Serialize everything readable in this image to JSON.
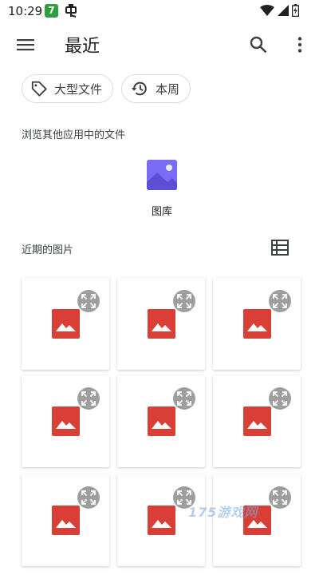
{
  "status_bar": {
    "time": "10:29",
    "app_badge": "7"
  },
  "app_bar": {
    "title": "最近",
    "menu_icon": "menu-icon",
    "search_icon": "search-icon",
    "more_icon": "more-vert-icon"
  },
  "filters": [
    {
      "label": "大型文件",
      "icon": "label-tag-icon"
    },
    {
      "label": "本周",
      "icon": "history-icon"
    }
  ],
  "browse_section": {
    "heading": "浏览其他应用中的文件",
    "apps": [
      {
        "label": "图库",
        "icon": "gallery-icon",
        "color": "#7b6cf6"
      }
    ]
  },
  "recent_section": {
    "heading": "近期的图片",
    "view_icon": "list-view-icon"
  },
  "thumbnails": [
    {
      "icon": "image-placeholder-icon"
    },
    {
      "icon": "image-placeholder-icon"
    },
    {
      "icon": "image-placeholder-icon"
    },
    {
      "icon": "image-placeholder-icon"
    },
    {
      "icon": "image-placeholder-icon"
    },
    {
      "icon": "image-placeholder-icon"
    },
    {
      "icon": "image-placeholder-icon"
    },
    {
      "icon": "image-placeholder-icon"
    },
    {
      "icon": "image-placeholder-icon"
    }
  ],
  "watermark": "175游戏网",
  "colors": {
    "image_red": "#d93f36",
    "expand_grey": "#9e9e9e",
    "gallery_purple": "#7b6cf6"
  }
}
